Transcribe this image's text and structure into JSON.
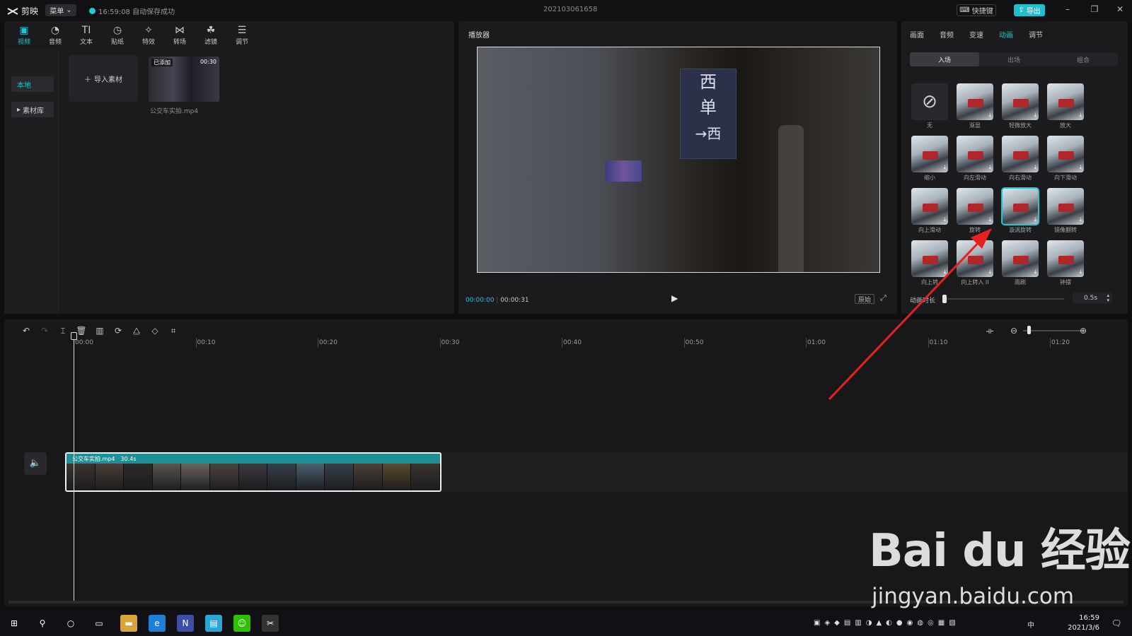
{
  "titlebar": {
    "app_name": "剪映",
    "menu_label": "菜单",
    "save_status": "16:59:08 自动保存成功",
    "project_title": "202103061658",
    "shortcut_label": "快捷键",
    "export_label": "导出"
  },
  "media_toolbar": [
    {
      "label": "视频",
      "icon": "video-icon"
    },
    {
      "label": "音频",
      "icon": "audio-icon"
    },
    {
      "label": "文本",
      "icon": "text-icon"
    },
    {
      "label": "贴纸",
      "icon": "sticker-icon"
    },
    {
      "label": "特效",
      "icon": "effects-icon"
    },
    {
      "label": "转场",
      "icon": "transition-icon"
    },
    {
      "label": "滤镜",
      "icon": "filter-icon"
    },
    {
      "label": "调节",
      "icon": "adjust-icon"
    }
  ],
  "media_sidebar": {
    "local": "本地",
    "library": "素材库"
  },
  "media": {
    "import_label": "导入素材",
    "clip": {
      "added_tag": "已添加",
      "duration": "00:30",
      "filename": "公交车实拍.mp4"
    }
  },
  "player": {
    "title": "播放器",
    "time_current": "00:00:00",
    "time_total": "00:00:31",
    "original_label": "原始"
  },
  "props": {
    "tabs": [
      "画面",
      "音频",
      "变速",
      "动画",
      "调节"
    ],
    "active_tab": "动画",
    "subtabs": [
      "入场",
      "出场",
      "组合"
    ],
    "animations": [
      {
        "label": "无",
        "none": true
      },
      {
        "label": "渐显"
      },
      {
        "label": "轻微放大"
      },
      {
        "label": "放大"
      },
      {
        "label": "缩小"
      },
      {
        "label": "向左滑动"
      },
      {
        "label": "向右滑动"
      },
      {
        "label": "向下滑动"
      },
      {
        "label": "向上滑动"
      },
      {
        "label": "旋转"
      },
      {
        "label": "漩涡旋转",
        "selected": true
      },
      {
        "label": "镜像翻转"
      },
      {
        "label": "向上转"
      },
      {
        "label": "向上转入 II"
      },
      {
        "label": "雨刷"
      },
      {
        "label": "钟摆"
      }
    ],
    "duration_label": "动画时长",
    "duration_value": "0.5s",
    "duration_level": 0.0
  },
  "timeline": {
    "ruler": [
      "00:00",
      "00:10",
      "00:20",
      "00:30",
      "00:40",
      "00:50",
      "01:00",
      "01:10",
      "01:20"
    ],
    "clip_name": "公交车实拍.mp4",
    "clip_duration": "30.4s"
  },
  "watermark": {
    "brand": "Bai du 经验",
    "url": "jingyan.baidu.com"
  },
  "taskbar": {
    "time": "16:59",
    "date": "2021/3/6",
    "ime": "中"
  },
  "colors": {
    "accent": "#1fc6d6",
    "arrow": "#e8201e"
  }
}
